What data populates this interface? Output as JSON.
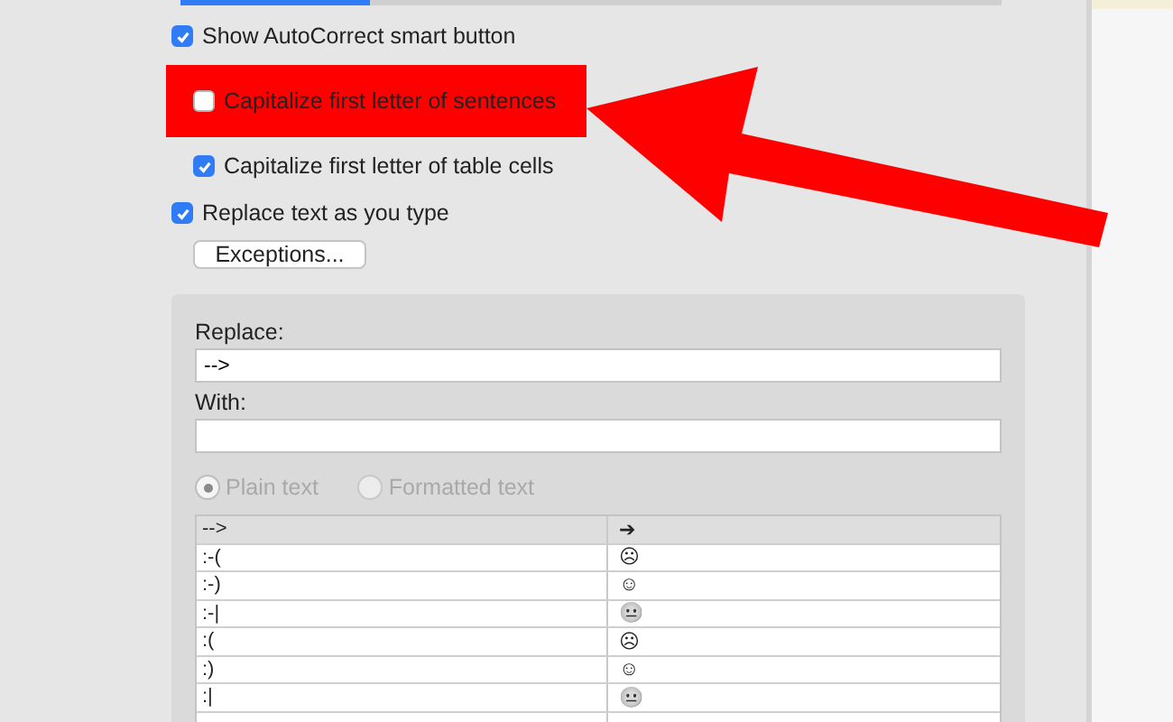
{
  "options": [
    {
      "label": "Show AutoCorrect smart button",
      "checked": true,
      "indented": false,
      "highlighted": false
    },
    {
      "label": "Capitalize first letter of sentences",
      "checked": false,
      "indented": true,
      "highlighted": true
    },
    {
      "label": "Capitalize first letter of table cells",
      "checked": true,
      "indented": true,
      "highlighted": false
    },
    {
      "label": "Replace text as you type",
      "checked": true,
      "indented": false,
      "highlighted": false
    }
  ],
  "exceptions_button": "Exceptions...",
  "replace": {
    "label": "Replace:",
    "value": "-->"
  },
  "with": {
    "label": "With:"
  },
  "format_options": [
    {
      "label": "Plain text",
      "selected": true,
      "disabled": true
    },
    {
      "label": "Formatted text",
      "selected": false,
      "disabled": true
    }
  ],
  "table": {
    "rows": [
      {
        "column_1": "-->",
        "column_2": "➔",
        "kind": "header"
      },
      {
        "column_1": ":-(",
        "column_2": "☹",
        "kind": "row"
      },
      {
        "column_1": ":-)",
        "column_2": "☺",
        "kind": "row"
      },
      {
        "column_1": ":-|",
        "column_2": "😐",
        "kind": "row"
      },
      {
        "column_1": ":(",
        "column_2": "☹",
        "kind": "row"
      },
      {
        "column_1": ":)",
        "column_2": "☺",
        "kind": "row"
      },
      {
        "column_1": ":|",
        "column_2": "😐",
        "kind": "row"
      }
    ]
  }
}
